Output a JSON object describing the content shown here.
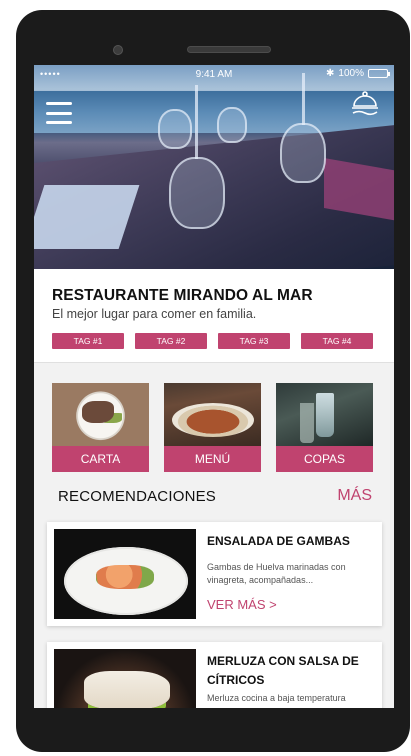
{
  "status_bar": {
    "signal": "•••••",
    "time": "9:41 AM",
    "battery": "100%",
    "battery_level": 1.0,
    "bluetooth": "✱"
  },
  "restaurant": {
    "name": "RESTAURANTE MIRANDO AL MAR",
    "tagline": "El mejor lugar para comer en familia."
  },
  "tags": [
    "TAG #1",
    "TAG #2",
    "TAG #3",
    "TAG #4"
  ],
  "categories": [
    {
      "label": "CARTA"
    },
    {
      "label": "MENÚ"
    },
    {
      "label": "COPAS"
    }
  ],
  "recommendations": {
    "title": "RECOMENDACIONES",
    "more_label": "MÁS",
    "items": [
      {
        "name": "ENSALADA DE GAMBAS",
        "description": "Gambas de Huelva marinadas con vinagreta, acompañadas...",
        "more": "VER MÁS >"
      },
      {
        "name": "MERLUZA CON SALSA DE CÍTRICOS",
        "description": "Merluza cocina a baja temperatura"
      }
    ]
  },
  "colors": {
    "accent": "#c0436f",
    "phone_body": "#1b1b1b",
    "screen_bg": "#f2f2f2"
  },
  "icons": {
    "menu": "hamburger-icon",
    "cloche": "cloche-icon",
    "camera": "camera-icon"
  }
}
